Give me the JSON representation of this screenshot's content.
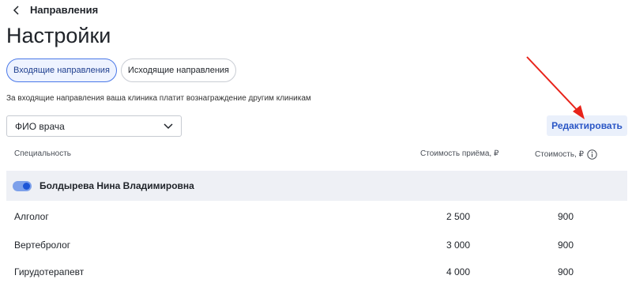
{
  "header": {
    "back_label": "Направления",
    "title": "Настройки"
  },
  "tabs": [
    {
      "label": "Входящие направления",
      "active": true
    },
    {
      "label": "Исходящие направления",
      "active": false
    }
  ],
  "description": "За входящие направления ваша клиника платит вознаграждение другим клиникам",
  "doctor_select": {
    "placeholder": "ФИО врача"
  },
  "edit_button": {
    "label": "Редактировать"
  },
  "table": {
    "headers": {
      "specialty": "Специальность",
      "visit_cost": "Стоимость приёма, ₽",
      "cost": "Стоимость, ₽"
    },
    "doctor": {
      "name": "Болдырева Нина Владимировна",
      "enabled": true
    },
    "rows": [
      {
        "specialty": "Алголог",
        "visit_cost": "2 500",
        "cost": "900"
      },
      {
        "specialty": "Вертебролог",
        "visit_cost": "3 000",
        "cost": "900"
      },
      {
        "specialty": "Гирудотерапевт",
        "visit_cost": "4 000",
        "cost": "900"
      }
    ]
  },
  "colors": {
    "accent": "#2a56c6",
    "annotation_arrow": "#e8231a",
    "row_highlight": "#eef0f5"
  }
}
